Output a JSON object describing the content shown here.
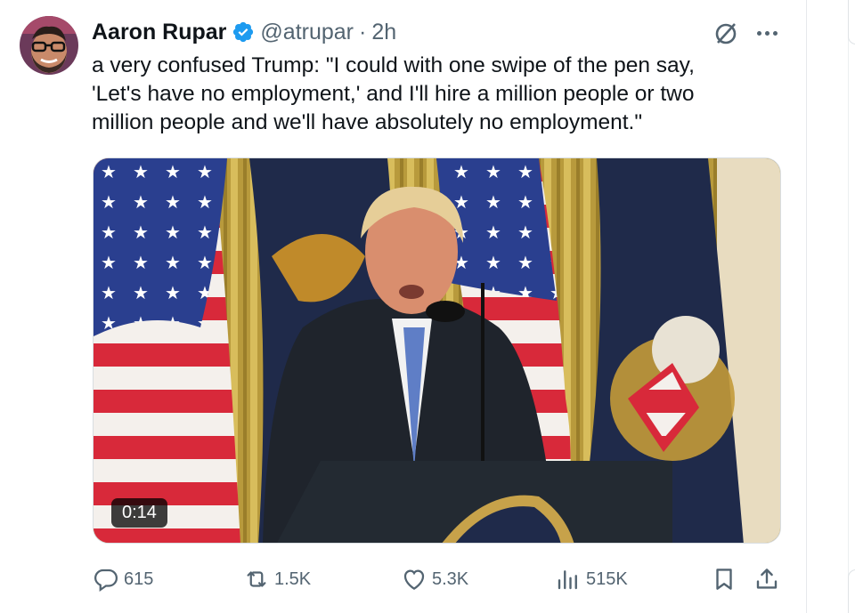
{
  "tweet": {
    "author": {
      "display_name": "Aaron Rupar",
      "handle": "@atrupar",
      "verified": true,
      "avatar": "avatar"
    },
    "separator": "·",
    "time": "2h",
    "text_lines": [
      "a very confused Trump: \"I could with one swipe of the pen say,",
      "'Let's have no employment,' and I'll hire a million people or two",
      "million people and we'll have absolutely no employment.\""
    ],
    "media": {
      "type": "video",
      "duration": "0:14"
    },
    "actions": {
      "replies": "615",
      "reposts": "1.5K",
      "likes": "5.3K",
      "views": "515K"
    }
  },
  "icons": {
    "verified": "verified-badge-icon",
    "grok": "grok-icon",
    "more": "more-icon",
    "reply": "reply-icon",
    "repost": "repost-icon",
    "like": "heart-icon",
    "views": "views-icon",
    "bookmark": "bookmark-icon",
    "share": "share-icon"
  },
  "colors": {
    "text": "#0f1419",
    "secondary": "#536471",
    "verified": "#1d9bf0"
  }
}
